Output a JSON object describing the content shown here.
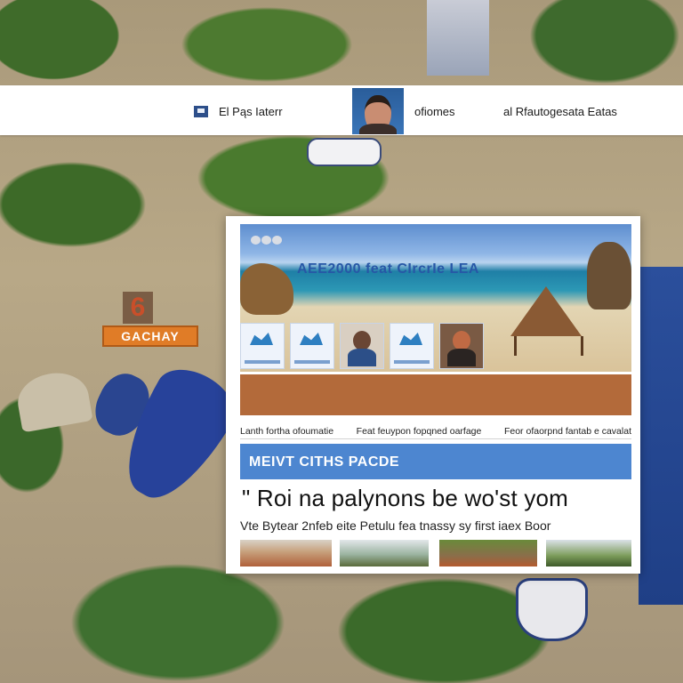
{
  "background": {
    "sign_text": "GACHAY",
    "marker_text": "6"
  },
  "topbar": {
    "left_label": "El Pąs Iaterr",
    "center_label": "ofiomes",
    "right_label": "al  Rfautogesata Eatas"
  },
  "card": {
    "hero_title": "AEE2000 feat CIrcrIe LEA",
    "columns": [
      "Lanth fortha ofoumatie",
      "Feat feuypon fopqned oarfage",
      "Feor ofaorpnd fantab e cavalat"
    ],
    "banner": "MEIVT CITHS PACDE",
    "headline": "\" Roi na palynons be wo'st yom",
    "subline": "Vte Bytear 2nfeb eite Petulu fea tnassy sy first iaex Boor"
  },
  "colors": {
    "accent_blue": "#4d86d0",
    "band_brown": "#b36a3a",
    "topbar_bg": "#ffffff"
  }
}
